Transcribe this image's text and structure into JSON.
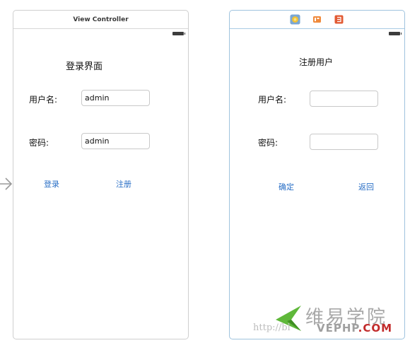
{
  "left_scene": {
    "title": "View Controller",
    "heading": "登录界面",
    "username_label": "用户名:",
    "username_value": "admin",
    "password_label": "密码:",
    "password_value": "admin",
    "login_button": "登录",
    "register_button": "注册"
  },
  "right_scene": {
    "heading": "注册用户",
    "username_label": "用户名:",
    "username_value": "",
    "password_label": "密码:",
    "password_value": "",
    "confirm_button": "确定",
    "back_button": "返回",
    "scene_dock_icons": [
      "view-controller-icon",
      "first-responder-icon",
      "exit-icon"
    ]
  },
  "watermark": {
    "title": "维易学院",
    "url": "http://bl",
    "site_prefix": "VEPHP",
    "site_suffix": ".COM"
  },
  "colors": {
    "link": "#2a6fc6",
    "selected_scene_border": "#9fc3de",
    "scene_border": "#cfcfcf",
    "vc_icon": "#f2c232",
    "exit_icon": "#e25b34"
  }
}
